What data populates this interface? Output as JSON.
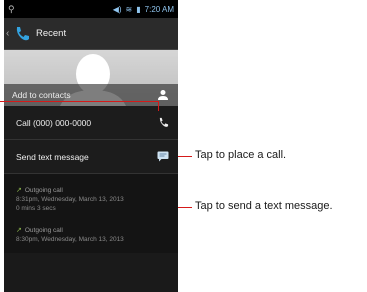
{
  "status_bar": {
    "time": "7:20 AM"
  },
  "action_bar": {
    "title": "Recent"
  },
  "contact": {
    "add_label": "Add to contacts"
  },
  "actions": [
    {
      "label": "Call (000) 000-0000",
      "icon": "phone-icon"
    },
    {
      "label": "Send text message",
      "icon": "message-icon"
    }
  ],
  "call_log": [
    {
      "type": "Outgoing call",
      "date": "8:31pm, Wednesday, March 13, 2013",
      "duration": "0 mins 3 secs"
    },
    {
      "type": "Outgoing call",
      "date": "8:30pm, Wednesday, March 13, 2013",
      "duration": ""
    }
  ],
  "callouts": {
    "call": "Tap to place a call.",
    "text": "Tap to send a text message."
  },
  "colors": {
    "callout_line": "#d51a1a",
    "accent_blue": "#33a3e0"
  }
}
